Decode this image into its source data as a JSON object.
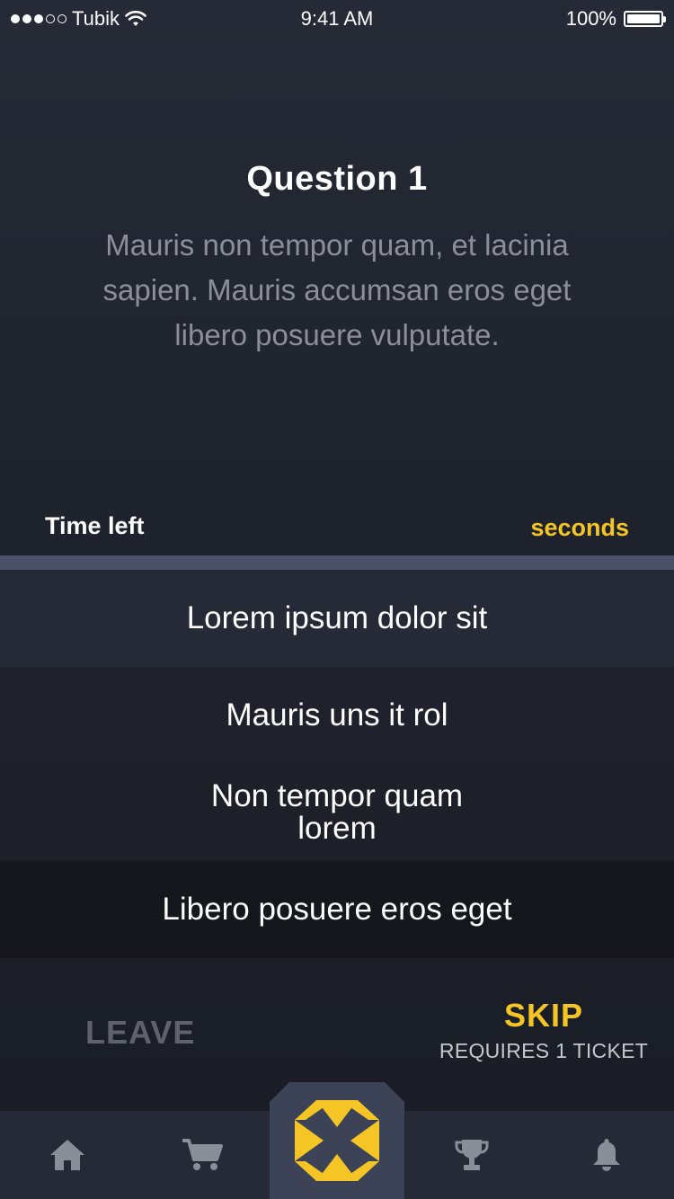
{
  "status_bar": {
    "carrier": "Tubik",
    "time": "9:41 AM",
    "battery": "100%",
    "signal_bars_full": 3,
    "signal_bars_total": 5
  },
  "question": {
    "title": "Question 1",
    "text": "Mauris non tempor quam, et lacinia sapien. Mauris accumsan eros eget libero posuere vulputate."
  },
  "timer": {
    "label": "Time left",
    "unit": "seconds"
  },
  "answers": [
    "Lorem ipsum dolor sit",
    "Mauris uns it rol",
    "Non tempor quam lorem",
    "Libero posuere eros eget"
  ],
  "actions": {
    "leave_label": "LEAVE",
    "skip_label": "SKIP",
    "skip_sublabel": "REQUIRES 1 TICKET"
  },
  "tab_bar": {
    "icons": [
      "home-icon",
      "cart-icon",
      "quiz-logo-icon",
      "trophy-icon",
      "bell-icon"
    ],
    "active": "quiz-logo-icon"
  },
  "colors": {
    "accent": "#f5c525",
    "background": "#1f232d",
    "tab_bar": "#262a37",
    "center_tab": "#3c4357",
    "inactive_icon": "#8a8e99",
    "muted_text": "#8c8f99"
  }
}
